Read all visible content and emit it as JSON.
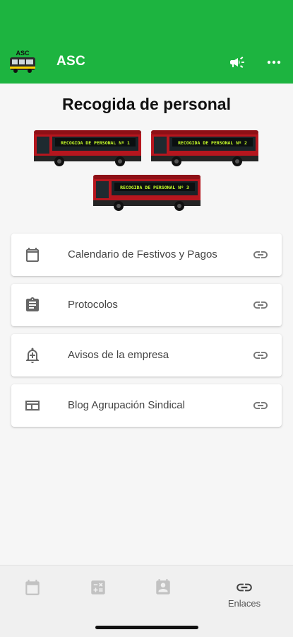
{
  "app": {
    "title": "ASC",
    "logo_text": "ASC"
  },
  "header": {
    "title": "Recogida de personal"
  },
  "buses": [
    {
      "sign": "RECOGIDA DE PERSONAL Nº 1"
    },
    {
      "sign": "RECOGIDA DE PERSONAL Nº 2"
    },
    {
      "sign": "RECOGIDA DE PERSONAL Nº 3"
    }
  ],
  "links": [
    {
      "label": "Calendario de Festivos y Pagos",
      "icon": "calendar-icon"
    },
    {
      "label": "Protocolos",
      "icon": "clipboard-icon"
    },
    {
      "label": "Avisos de la empresa",
      "icon": "notification-add-icon"
    },
    {
      "label": "Blog Agrupación Sindical",
      "icon": "web-icon"
    }
  ],
  "bottom_nav": [
    {
      "label": "",
      "icon": "calendar-icon"
    },
    {
      "label": "",
      "icon": "calculator-icon"
    },
    {
      "label": "",
      "icon": "badge-icon"
    },
    {
      "label": "Enlaces",
      "icon": "link-icon"
    }
  ],
  "colors": {
    "primary": "#1db440",
    "bus_body": "#b5161e",
    "sign_text": "#c8ff2a"
  }
}
